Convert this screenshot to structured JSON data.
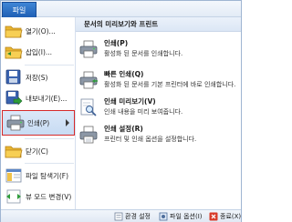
{
  "file_tab": {
    "label": "파일"
  },
  "left_menu": {
    "items": [
      {
        "label": "열기(O)...",
        "icon": "folder-open-icon"
      },
      {
        "label": "삽입(I)...",
        "icon": "folder-insert-icon"
      },
      {
        "label": "저장(S)",
        "icon": "save-icon"
      },
      {
        "label": "내보내기(E)...",
        "icon": "export-icon"
      },
      {
        "label": "인쇄(P)",
        "icon": "printer-icon"
      },
      {
        "label": "닫기(C)",
        "icon": "close-folder-icon"
      },
      {
        "label": "파일 탐색기(F)",
        "icon": "file-explorer-icon"
      },
      {
        "label": "뷰 모드 변경(V)",
        "icon": "view-mode-icon"
      }
    ]
  },
  "print_panel": {
    "header": "문서의 미리보기와 프린트",
    "options": [
      {
        "title": "인쇄(P)",
        "description": "활성화 된 문서를 인쇄합니다.",
        "icon": "printer-icon"
      },
      {
        "title": "빠른 인쇄(Q)",
        "description": "활성화 된 문서를 기본 프린터에 바로 인쇄합니다.",
        "icon": "quick-print-icon"
      },
      {
        "title": "인쇄 미리보기(V)",
        "description": "인쇄 내용을 미리 보여줍니다.",
        "icon": "print-preview-icon"
      },
      {
        "title": "인쇄 설정(R)",
        "description": "프린터 및 인쇄 옵션을 설정합니다.",
        "icon": "print-setup-icon"
      }
    ]
  },
  "bottom_bar": {
    "env_settings": "환경 설정",
    "file_options": "파일 옵션(I)",
    "exit": "종료(X)"
  },
  "colors": {
    "selection_border": "#d62a2a",
    "file_tab_bg": "#1f5fb4",
    "selection_bg": "#c7dbf3"
  }
}
